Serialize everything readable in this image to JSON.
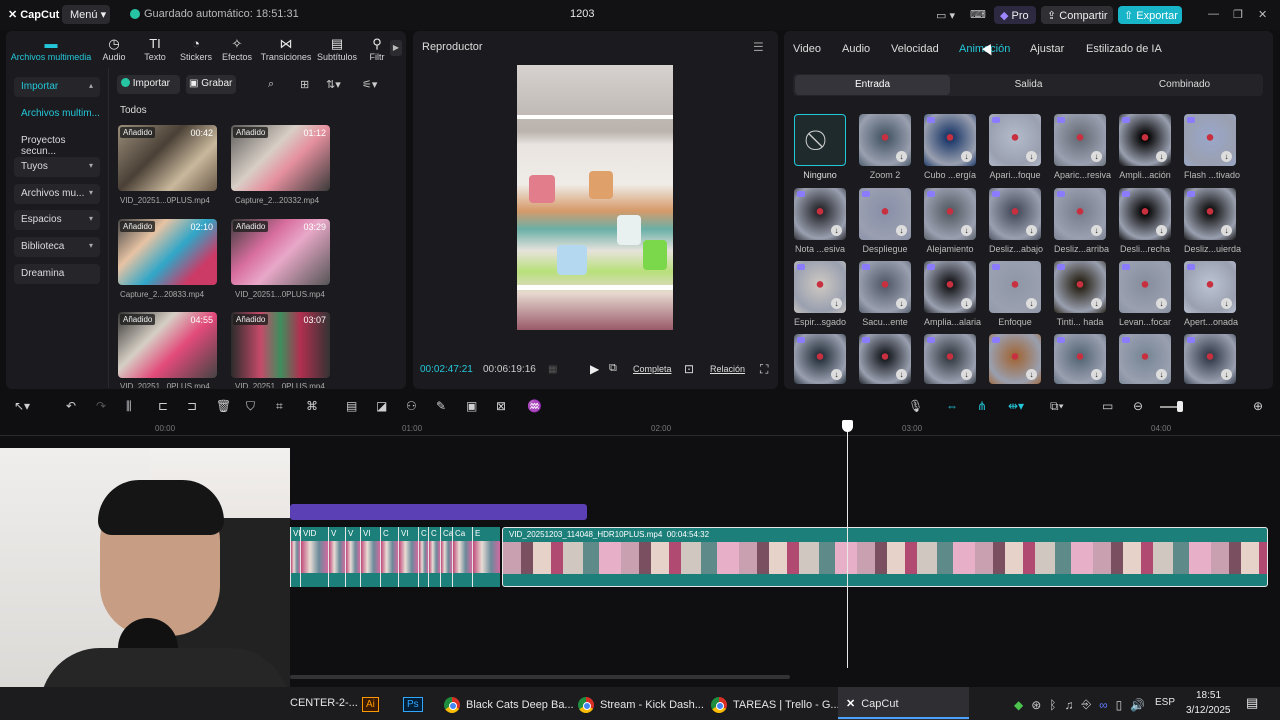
{
  "titlebar": {
    "app": "CapCut",
    "menu": "Menú",
    "autosave": "Guardado automático: 18:51:31",
    "project": "1203",
    "pro": "Pro",
    "share": "Compartir",
    "export": "Exportar"
  },
  "media_tabs": [
    "Archivos multimedia",
    "Audio",
    "Texto",
    "Stickers",
    "Efectos",
    "Transiciones",
    "Subtítulos",
    "Filtr"
  ],
  "sidebar": {
    "items": [
      {
        "label": "Importar"
      },
      {
        "label": "Archivos multim..."
      },
      {
        "label": "Proyectos secun..."
      },
      {
        "label": "Tuyos"
      },
      {
        "label": "Archivos mu..."
      },
      {
        "label": "Espacios"
      },
      {
        "label": "Biblioteca"
      },
      {
        "label": "Dreamina"
      }
    ]
  },
  "media": {
    "import": "Importar",
    "record": "Grabar",
    "section": "Todos",
    "items": [
      {
        "badge": "Añadido",
        "duration": "00:42",
        "name": "VID_20251...0PLUS.mp4"
      },
      {
        "badge": "Añadido",
        "duration": "01:12",
        "name": "Capture_2...20332.mp4"
      },
      {
        "badge": "Añadido",
        "duration": "02:10",
        "name": "Capture_2...20833.mp4"
      },
      {
        "badge": "Añadido",
        "duration": "03:29",
        "name": "VID_20251...0PLUS.mp4"
      },
      {
        "badge": "Añadido",
        "duration": "04:55",
        "name": "VID_20251...0PLUS.mp4"
      },
      {
        "badge": "Añadido",
        "duration": "03:07",
        "name": "VID_20251...0PLUS.mp4"
      }
    ]
  },
  "player": {
    "title": "Reproductor",
    "current": "00:02:47:21",
    "total": "00:06:19:16",
    "complete": "Completa",
    "ratio": "Relación"
  },
  "props": {
    "tabs": [
      "Video",
      "Audio",
      "Velocidad",
      "Animación",
      "Ajustar",
      "Estilizado de IA"
    ],
    "subtabs": [
      "Entrada",
      "Salida",
      "Combinado"
    ],
    "animations": [
      "Ninguno",
      "Zoom 2",
      "Cubo ...ergía",
      "Apari...foque",
      "Aparic...resiva",
      "Ampli...ación",
      "Flash ...tivado",
      "Nota ...esiva",
      "Despliegue",
      "Alejamiento",
      "Desliz...abajo",
      "Desliz...arriba",
      "Desli...recha",
      "Desliz...uierda",
      "Espir...sgado",
      "Sacu...ente",
      "Amplia...alaria",
      "Enfoque",
      "Tinti... hada",
      "Levan...focar",
      "Apert...onada",
      "",
      "",
      "",
      "",
      "",
      "",
      ""
    ]
  },
  "timeline": {
    "ticks": [
      "00:00",
      "01:00",
      "02:00",
      "03:00",
      "04:00"
    ],
    "clip_label": "VID_20251203_114048_HDR10PLUS.mp4",
    "clip_duration": "00:04:54:32",
    "small_clips": [
      "VI",
      "VID",
      "V",
      "V",
      "VI",
      "C",
      "VI",
      "C",
      "C",
      "Ca",
      "Ca",
      "E"
    ]
  },
  "taskbar": {
    "items": [
      "CENTER-2-...",
      "Black Cats Deep Ba...",
      "Stream - Kick Dash...",
      "TAREAS | Trello - G...",
      "CapCut"
    ],
    "lang": "ESP",
    "time": "18:51",
    "date": "3/12/2025"
  },
  "colors": {
    "accent": "#24c7d9",
    "export": "#18b5c9",
    "clip": "#1c7f7a",
    "purple": "#5a3fb5"
  }
}
